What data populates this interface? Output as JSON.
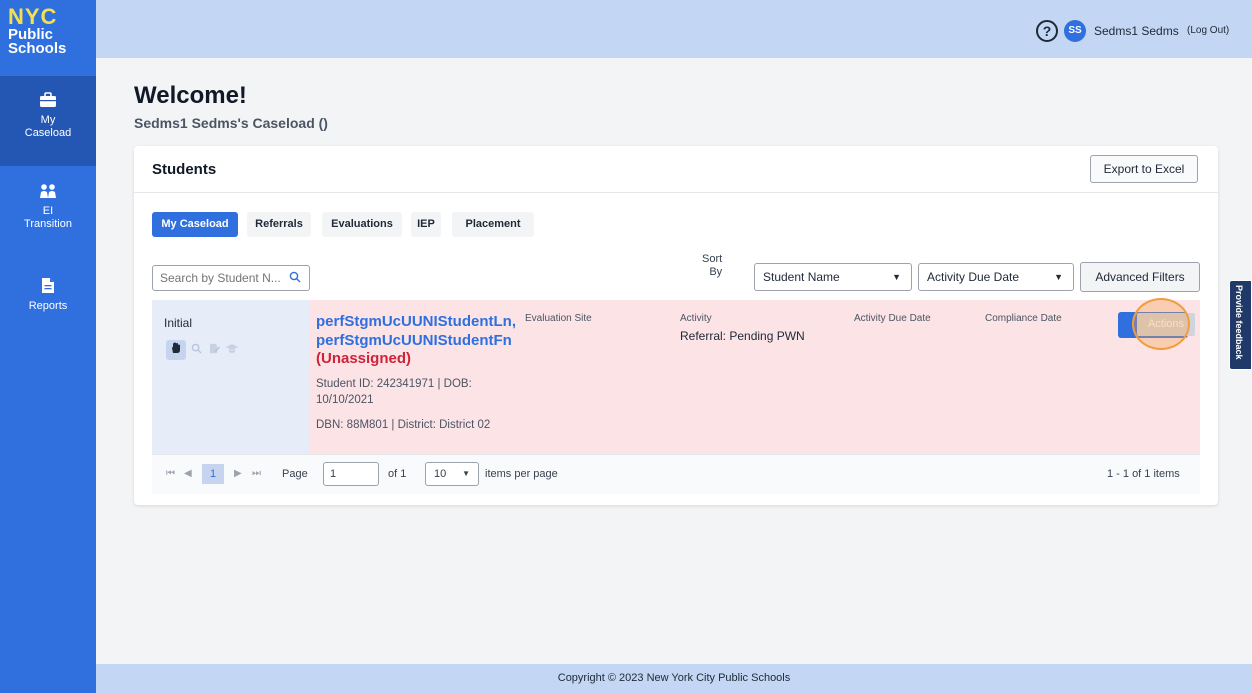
{
  "brand": {
    "logo_top": "NYC",
    "logo_bottom": "Public Schools"
  },
  "sidebar": {
    "items": [
      {
        "label": "My\nCaseload",
        "icon": "briefcase-icon",
        "active": true
      },
      {
        "label": "EI\nTransition",
        "icon": "people-icon",
        "active": false
      },
      {
        "label": "Reports",
        "icon": "document-icon",
        "active": false
      }
    ]
  },
  "header": {
    "help_icon": "?",
    "avatar_initials": "SS",
    "user_name": "Sedms1 Sedms",
    "logout_label": "(Log Out)"
  },
  "page": {
    "welcome": "Welcome!",
    "caseload_title": "Sedms1 Sedms's Caseload ()"
  },
  "card": {
    "title": "Students",
    "export_label": "Export to Excel",
    "tabs": [
      "My Caseload",
      "Referrals",
      "Evaluations",
      "IEP",
      "Placement"
    ],
    "active_tab": "My Caseload",
    "search_placeholder": "Search by Student N...",
    "sort_label": "Sort\nBy",
    "sort_value": "Student Name",
    "date_filter_value": "Activity Due Date",
    "advanced_filters_label": "Advanced Filters"
  },
  "row": {
    "status": "Initial",
    "student_name": "perfStgmUcUUNIStudentLn, perfStgmUcUUNIStudentFn",
    "assignment": "(Unassigned)",
    "student_id_dob": "Student ID: 242341971 | DOB: 10/10/2021",
    "dbn_district": "DBN: 88M801 | District: District 02",
    "col_evaluation_site": "Evaluation Site",
    "col_activity": "Activity",
    "activity_value": "Referral: Pending PWN",
    "col_activity_due": "Activity Due Date",
    "col_compliance": "Compliance Date",
    "actions_label": "Actions"
  },
  "pager": {
    "first": "⏮",
    "prev": "◀",
    "current_page": "1",
    "next": "▶",
    "last": "⏭",
    "page_label": "Page",
    "page_value": "1",
    "of_label": "of 1",
    "page_size": "10",
    "items_per_page_label": "items per page",
    "summary": "1 - 1 of 1 items"
  },
  "feedback_label": "Provide feedback",
  "footer": {
    "copyright": "Copyright © 2023 New York City Public Schools"
  },
  "colors": {
    "primary": "#2f6fde",
    "header_bg": "#c3d6f3",
    "row_bg": "#fbe3e6",
    "unassigned": "#d0233a",
    "highlight": "#f39c3d"
  }
}
